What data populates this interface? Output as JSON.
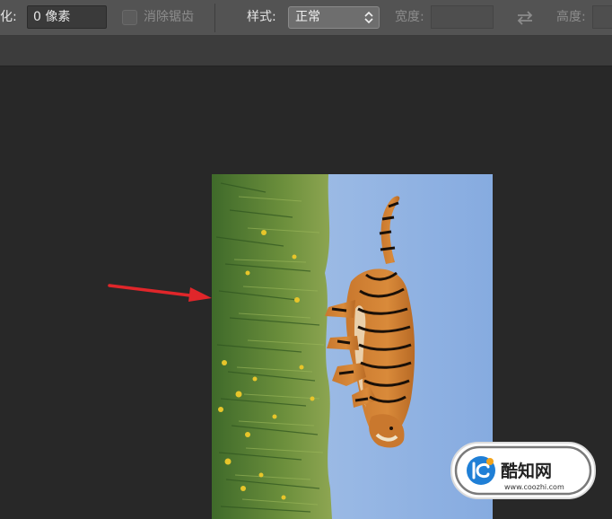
{
  "options_bar": {
    "feather_label": "羽化:",
    "feather_label_visible": "化:",
    "feather_value": "0 像素",
    "anti_alias_label": "消除锯齿",
    "anti_alias_checked": false,
    "style_label": "样式:",
    "style_value": "正常",
    "width_label": "宽度:",
    "width_value": "",
    "height_label": "高度:",
    "height_value": ""
  },
  "canvas": {
    "image_subject": "tiger in grass (rotated 90°)",
    "annotation": "red arrow pointing to image left edge"
  },
  "watermark": {
    "brand": "酷知网",
    "url": "www.coozhi.com"
  },
  "colors": {
    "options_bar_bg": "#535353",
    "canvas_bg": "#282828",
    "arrow": "#e0262a",
    "sky": "#8fb3e2",
    "grass": "#6b8e3a"
  }
}
